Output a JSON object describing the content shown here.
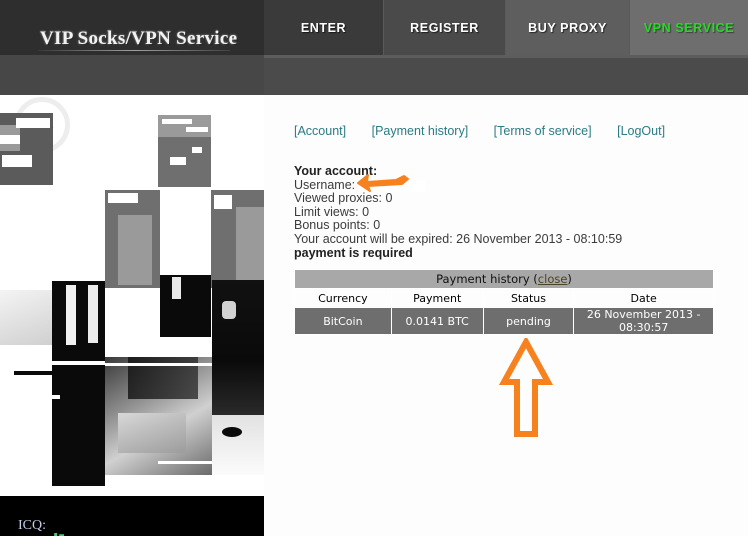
{
  "site": {
    "logo": "VIP Socks/VPN Service",
    "accent_green": "#22dd22",
    "link_color": "#2a7b84",
    "annotation_color": "#f5821f"
  },
  "nav": {
    "tabs": [
      {
        "label": "ENTER",
        "active": false
      },
      {
        "label": "REGISTER",
        "active": false
      },
      {
        "label": "BUY PROXY",
        "active": false
      },
      {
        "label": "VPN SERVICE",
        "active": true
      }
    ]
  },
  "account_links": [
    {
      "label": "[Account]"
    },
    {
      "label": "[Payment history]"
    },
    {
      "label": "[Terms of service]"
    },
    {
      "label": "[LogOut]"
    }
  ],
  "account": {
    "heading": "Your account:",
    "username_label": "Username:",
    "username_value": "",
    "viewed_proxies": "Viewed proxies: 0",
    "limit_views": "Limit views: 0",
    "bonus_points": "Bonus points: 0",
    "expiry": "Your account will be expired: 26 November 2013 - 08:10:59",
    "payment_notice": "payment is required"
  },
  "payment_history": {
    "title": "Payment history",
    "close_label": "close",
    "open_paren": "(",
    "close_paren": ")",
    "columns": [
      "Currency",
      "Payment",
      "Status",
      "Date"
    ],
    "rows": [
      {
        "currency": "BitCoin",
        "payment": "0.0141 BTC",
        "status": "pending",
        "date": "26 November 2013 - 08:30:57"
      }
    ]
  },
  "footer": {
    "icq_label": "ICQ:"
  },
  "annotations": [
    {
      "name": "username-arrow",
      "target": "username value",
      "shape": "hand-drawn-arrow-left"
    },
    {
      "name": "status-arrow",
      "target": "pending status",
      "shape": "outlined-arrow-up"
    }
  ]
}
